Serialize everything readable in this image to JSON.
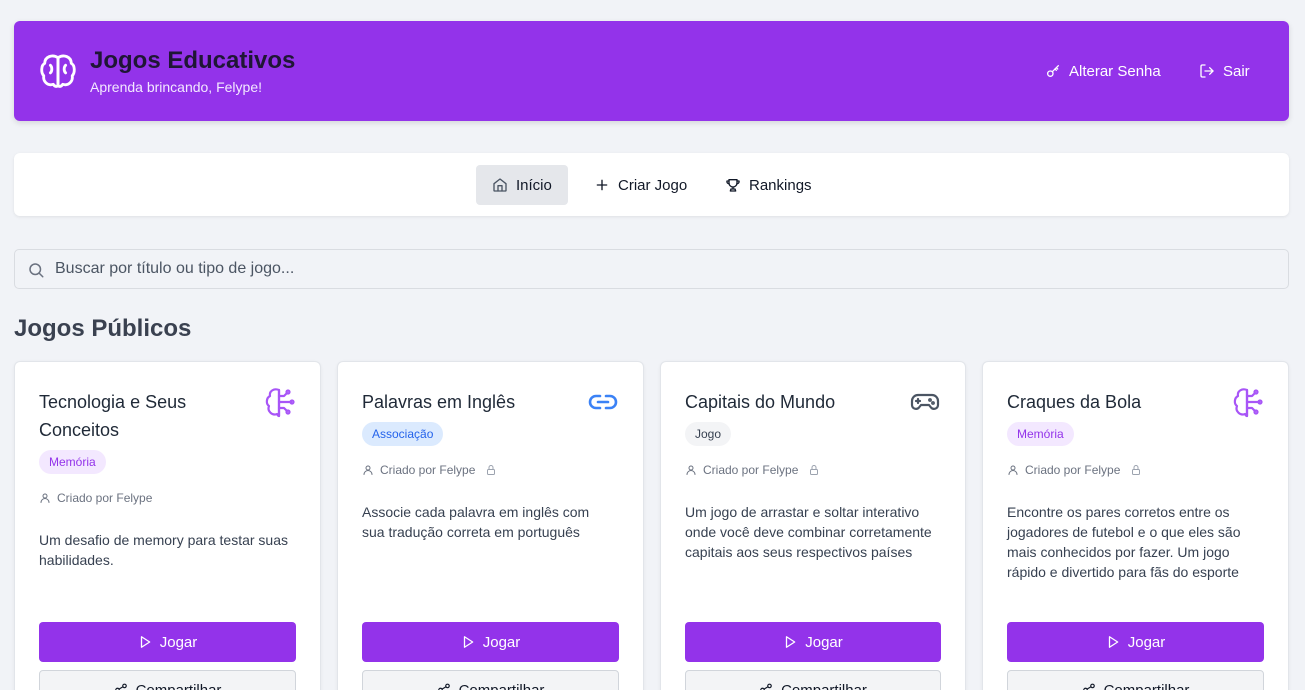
{
  "header": {
    "title": "Jogos Educativos",
    "subtitle": "Aprenda brincando, Felype!",
    "change_password": "Alterar Senha",
    "logout": "Sair",
    "brand_color": "#9333ea",
    "icons": {
      "logo": "brain-icon",
      "change_password": "key-icon",
      "logout": "logout-icon"
    }
  },
  "nav": {
    "items": [
      {
        "label": "Início",
        "icon": "home-icon",
        "active": true
      },
      {
        "label": "Criar Jogo",
        "icon": "plus-icon",
        "active": false
      },
      {
        "label": "Rankings",
        "icon": "trophy-icon",
        "active": false
      }
    ]
  },
  "search": {
    "placeholder": "Buscar por título ou tipo de jogo...",
    "value": ""
  },
  "section_title": "Jogos Públicos",
  "cards": [
    {
      "title": "Tecnologia e Seus Conceitos",
      "badge": "Memória",
      "creator": "Criado por Felype",
      "locked": false,
      "description": "Um desafio de memory para testar suas habilidades.",
      "icon": "brain-circuit-icon",
      "play_label": "Jogar",
      "share_label": "Compartilhar"
    },
    {
      "title": "Palavras em Inglês",
      "badge": "Associação",
      "creator": "Criado por Felype",
      "locked": true,
      "description": "Associe cada palavra em inglês com sua tradução correta em português",
      "icon": "link-icon",
      "play_label": "Jogar",
      "share_label": "Compartilhar"
    },
    {
      "title": "Capitais do Mundo",
      "badge": "Jogo",
      "creator": "Criado por Felype",
      "locked": true,
      "description": "Um jogo de arrastar e soltar interativo onde você deve combinar corretamente capitais aos seus respectivos países",
      "icon": "gamepad-icon",
      "play_label": "Jogar",
      "share_label": "Compartilhar"
    },
    {
      "title": "Craques da Bola",
      "badge": "Memória",
      "creator": "Criado por Felype",
      "locked": true,
      "description": "Encontre os pares corretos entre os jogadores de futebol e o que eles são mais conhecidos por fazer. Um jogo rápido e divertido para fãs do esporte",
      "icon": "brain-circuit-icon",
      "play_label": "Jogar",
      "share_label": "Compartilhar"
    }
  ]
}
